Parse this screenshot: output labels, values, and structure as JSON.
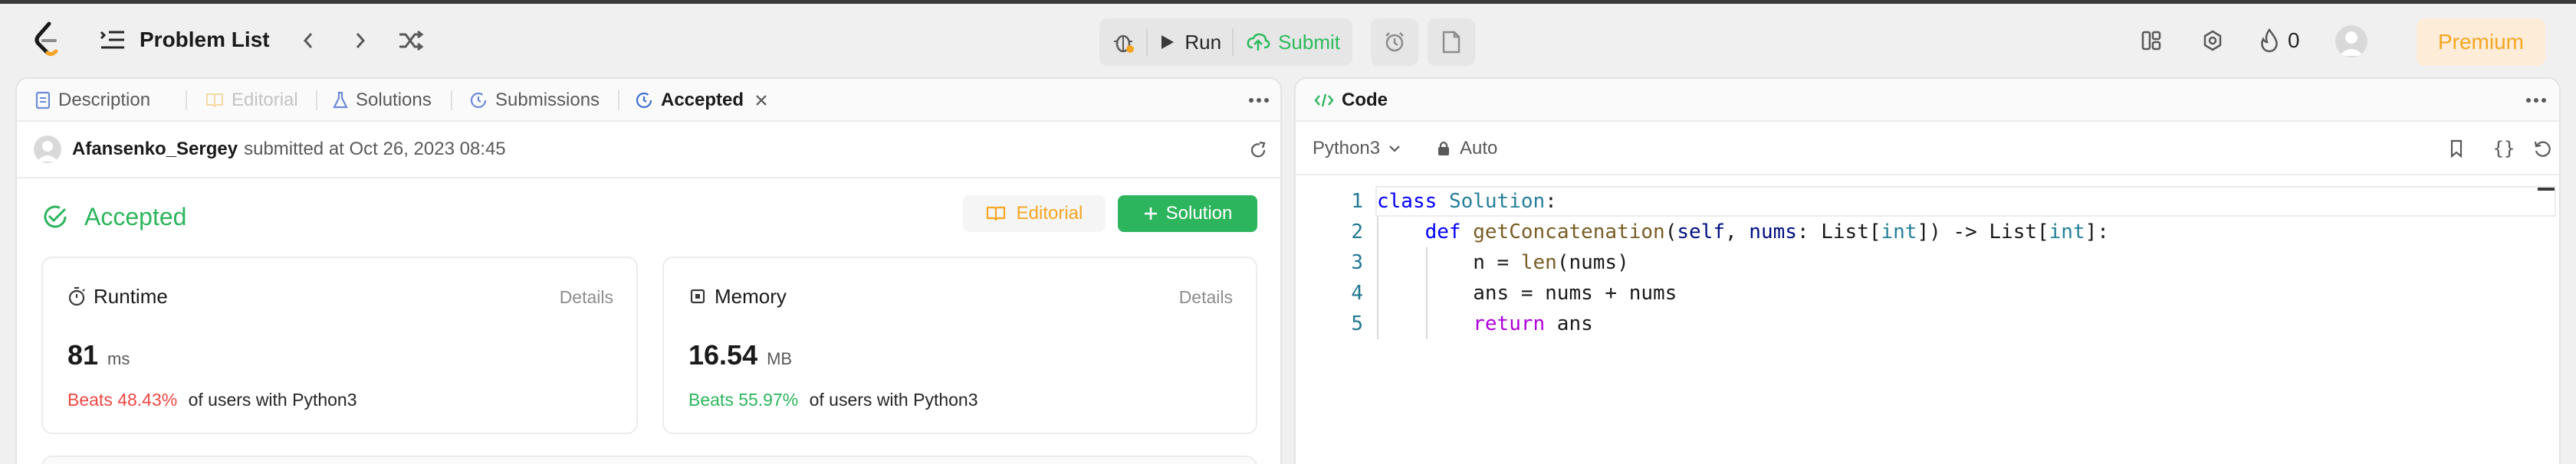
{
  "topbar": {
    "title": "Problem List",
    "run_label": "Run",
    "submit_label": "Submit",
    "streak_count": "0",
    "premium_label": "Premium"
  },
  "left_tabs": [
    {
      "label": "Description"
    },
    {
      "label": "Editorial"
    },
    {
      "label": "Solutions"
    },
    {
      "label": "Submissions"
    },
    {
      "label": "Accepted"
    }
  ],
  "submission": {
    "user": "Afansenko_Sergey",
    "submitted_text": "submitted at Oct 26, 2023 08:45",
    "status": "Accepted",
    "editorial_label": "Editorial",
    "solution_label": "Solution",
    "runtime": {
      "label": "Runtime",
      "details": "Details",
      "value": "81",
      "unit": "ms",
      "beats": "Beats 48.43%",
      "beats_suffix": "of users with Python3"
    },
    "memory": {
      "label": "Memory",
      "details": "Details",
      "value": "16.54",
      "unit": "MB",
      "beats": "Beats 55.97%",
      "beats_suffix": "of users with Python3"
    }
  },
  "code_panel": {
    "title": "Code",
    "language": "Python3",
    "mode": "Auto",
    "line_numbers": [
      "1",
      "2",
      "3",
      "4",
      "5"
    ],
    "lines": [
      [
        "class",
        " ",
        "Solution",
        ":"
      ],
      [
        "    ",
        "def",
        " ",
        "getConcatenation",
        "(",
        "self",
        ", ",
        "nums",
        ": List[",
        "int",
        "]) -> List[",
        "int",
        "]:"
      ],
      [
        "        n = ",
        "len",
        "(nums)"
      ],
      [
        "        ans = nums + nums"
      ],
      [
        "        ",
        "return",
        " ans"
      ]
    ]
  },
  "colors": {
    "accent_green": "#2cbb5d",
    "accepted_green": "#2db55d",
    "beats_red": "#ef4743",
    "beats_green": "#2db55d",
    "premium_orange": "#f5a623"
  }
}
